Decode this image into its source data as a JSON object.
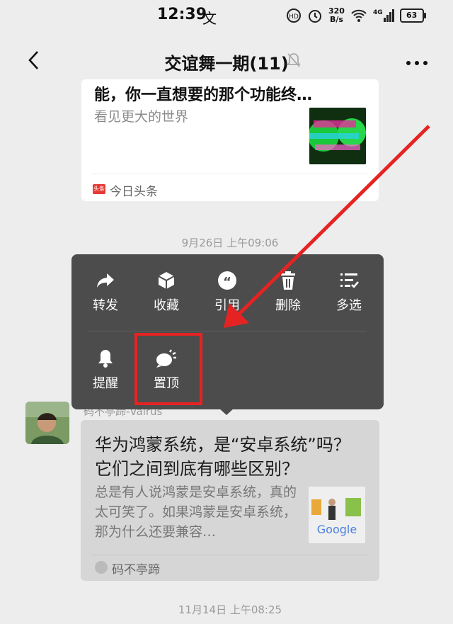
{
  "status": {
    "time": "12:39",
    "wen": "文",
    "speed_top": "320",
    "speed_bottom": "B/s",
    "net": "4G",
    "battery": "63"
  },
  "header": {
    "title": "交谊舞一期(11)"
  },
  "card1": {
    "headline": "能，你一直想要的那个功能终…",
    "desc": "看见更大的世界",
    "source_logo": "头条",
    "source": "今日头条"
  },
  "time1": "9月26日 上午09:06",
  "menu": {
    "items": [
      {
        "label": "转发",
        "icon": "forward-icon"
      },
      {
        "label": "收藏",
        "icon": "collect-box-icon"
      },
      {
        "label": "引用",
        "icon": "quote-icon"
      },
      {
        "label": "删除",
        "icon": "trash-icon"
      },
      {
        "label": "多选",
        "icon": "multi-select-icon"
      },
      {
        "label": "提醒",
        "icon": "bell-icon"
      },
      {
        "label": "置顶",
        "icon": "pin-top-bubble-icon"
      }
    ]
  },
  "sender": "码不亭蹄-Valrus",
  "card2": {
    "headline": "华为鸿蒙系统，是“安卓系统”吗？它们之间到底有哪些区别？",
    "desc": "总是有人说鸿蒙是安卓系统，真的太可笑了。如果鸿蒙是安卓系统，那为什么还要兼容…",
    "source": "码不亭蹄"
  },
  "time2": "11月14日 上午08:25",
  "colors": {
    "menu_bg": "#4c4c4c",
    "annotation_red": "#e62323",
    "chat_bg": "#ededed"
  }
}
